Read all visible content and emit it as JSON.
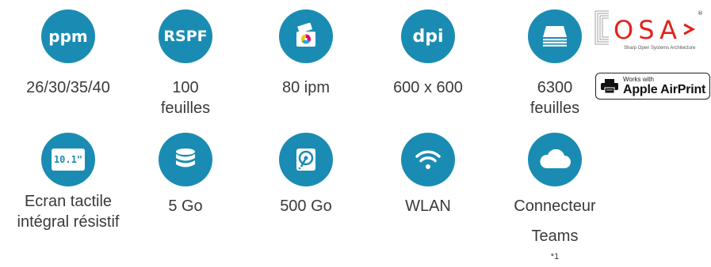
{
  "row1": [
    {
      "name": "ppm",
      "icon_text": "ppm",
      "label": [
        "26/30/35/40"
      ]
    },
    {
      "name": "rspf",
      "icon_text": "RSPF",
      "label": [
        "100",
        "feuilles"
      ]
    },
    {
      "name": "scan",
      "icon": "scanner-icon",
      "label": [
        "80 ipm"
      ]
    },
    {
      "name": "dpi",
      "icon_text": "dpi",
      "label": [
        "600 x 600"
      ]
    },
    {
      "name": "capacity",
      "icon": "paper-stack-icon",
      "label": [
        "6300",
        "feuilles"
      ]
    }
  ],
  "row2": [
    {
      "name": "screen",
      "icon_text": "10.1\"",
      "label": [
        "Ecran tactile",
        "intégral résistif"
      ]
    },
    {
      "name": "storage",
      "icon": "database-icon",
      "label": [
        "5 Go"
      ]
    },
    {
      "name": "hdd",
      "icon": "hard-drive-icon",
      "label": [
        "500 Go"
      ]
    },
    {
      "name": "wlan",
      "icon": "wifi-icon",
      "label": [
        "WLAN"
      ]
    },
    {
      "name": "teams",
      "icon": "cloud-icon",
      "label": [
        "Connecteur",
        "Teams"
      ],
      "footnote": "*1"
    }
  ],
  "osa": {
    "logo_text": "OSA",
    "tagline": "Sharp Open Systems Architecture",
    "registered": "®"
  },
  "airprint": {
    "small": "Works with",
    "big": "Apple AirPrint"
  },
  "colors": {
    "circle": "#1a8cb3",
    "text": "#3a3a3a"
  }
}
